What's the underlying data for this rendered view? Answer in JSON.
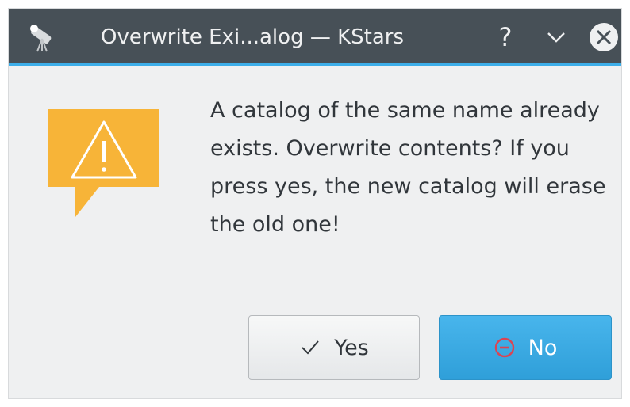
{
  "window": {
    "title": "Overwrite Exi...alog — KStars",
    "help_label": "?",
    "app_icon": "telescope-icon",
    "accent": "#3daee9"
  },
  "dialog": {
    "icon": "warning-icon",
    "message": "A catalog of the same name already exists. Overwrite contents? If you press yes, the new catalog will erase the old one!"
  },
  "buttons": {
    "yes": {
      "label": "Yes",
      "icon": "checkmark-icon"
    },
    "no": {
      "label": "No",
      "icon": "no-entry-icon",
      "color": "#3daee9"
    }
  },
  "colors": {
    "titlebar": "#475057",
    "warning": "#f7b438",
    "no_icon": "#da4453"
  }
}
